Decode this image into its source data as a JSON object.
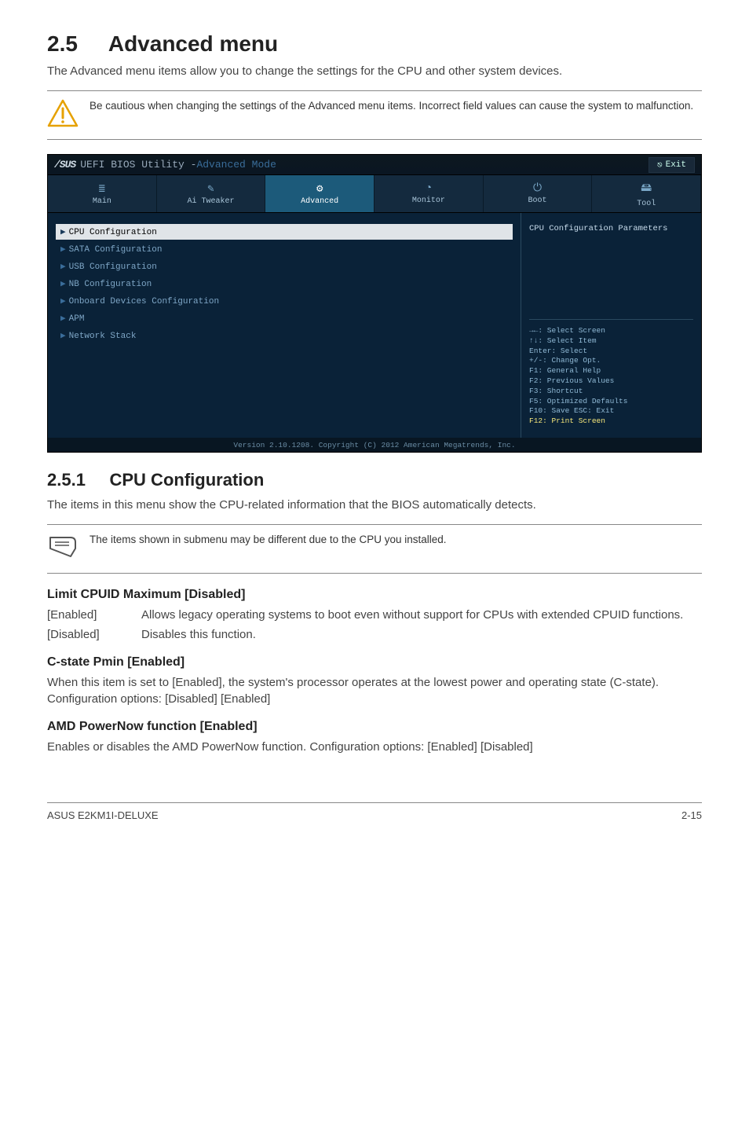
{
  "section": {
    "number": "2.5",
    "title": "Advanced menu",
    "intro": "The Advanced menu items allow you to change the settings for the CPU and other system devices."
  },
  "callout_warn": "Be cautious when changing the settings of the Advanced menu items. Incorrect field values can cause the system to malfunction.",
  "bios": {
    "logo": "/SUS",
    "title_1": "UEFI BIOS Utility - ",
    "title_2": "Advanced Mode",
    "exit": "Exit",
    "tabs": [
      {
        "label": "Main",
        "icon": "≣"
      },
      {
        "label": "Ai Tweaker",
        "icon": "✎"
      },
      {
        "label": "Advanced",
        "icon": "⚙"
      },
      {
        "label": "Monitor",
        "icon": "◔"
      },
      {
        "label": "Boot",
        "icon": "⏻"
      },
      {
        "label": "Tool",
        "icon": "🖴"
      }
    ],
    "active_tab": 2,
    "items": [
      "CPU Configuration",
      "SATA Configuration",
      "USB Configuration",
      "NB Configuration",
      "Onboard Devices Configuration",
      "APM",
      "Network Stack"
    ],
    "selected_item": 0,
    "side_heading": "CPU Configuration Parameters",
    "help": {
      "l1": "→←: Select Screen",
      "l2": "↑↓: Select Item",
      "l3": "Enter: Select",
      "l4": "+/-: Change Opt.",
      "l5": "F1: General Help",
      "l6": "F2: Previous Values",
      "l7": "F3: Shortcut",
      "l8": "F5: Optimized Defaults",
      "l9": "F10: Save  ESC: Exit",
      "l10": "F12: Print Screen"
    },
    "footer": "Version 2.10.1208. Copyright (C) 2012 American Megatrends, Inc."
  },
  "subsection": {
    "number": "2.5.1",
    "title": "CPU Configuration",
    "intro": "The items in this menu show the CPU-related information that the BIOS automatically detects."
  },
  "callout_note": "The items shown in submenu may be different due to the CPU you installed.",
  "opt1": {
    "heading": "Limit CPUID Maximum [Disabled]",
    "rows": [
      {
        "term": "[Enabled]",
        "desc": "Allows legacy operating systems to boot even without support for CPUs with extended CPUID functions."
      },
      {
        "term": "[Disabled]",
        "desc": "Disables this function."
      }
    ]
  },
  "opt2": {
    "heading": "C-state Pmin [Enabled]",
    "body": "When this item is set to [Enabled], the system's processor operates at the lowest power and operating state (C-state). Configuration options: [Disabled] [Enabled]"
  },
  "opt3": {
    "heading": "AMD PowerNow function [Enabled]",
    "body": "Enables or disables the AMD PowerNow function. Configuration options: [Enabled] [Disabled]"
  },
  "footer": {
    "left": "ASUS E2KM1I-DELUXE",
    "right": "2-15"
  }
}
